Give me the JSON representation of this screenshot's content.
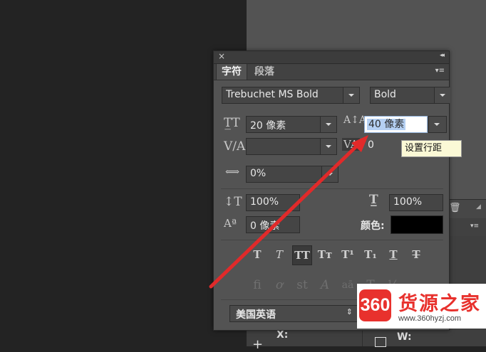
{
  "background": {
    "x_label": "X:",
    "w_label": "W:"
  },
  "panel": {
    "tabs": [
      {
        "label": "字符"
      },
      {
        "label": "段落"
      }
    ],
    "font_family": "Trebuchet MS Bold",
    "font_style": "Bold",
    "font_size": "20 像素",
    "leading": "40 像素",
    "kerning": "",
    "tracking": "0",
    "tsume": "0%",
    "vertical_scale": "100%",
    "horizontal_scale": "100%",
    "baseline_shift": "0 像素",
    "color_label": "颜色:",
    "color_value": "#000000",
    "language": "美国英语",
    "style_buttons": [
      "T",
      "T",
      "TT",
      "Tт",
      "T¹",
      "T₁",
      "T",
      "T"
    ],
    "opentype_buttons": [
      "fi",
      "ơ",
      "st",
      "A",
      "aā",
      "T",
      "½"
    ]
  },
  "tooltip": {
    "text": "设置行距"
  },
  "watermark": {
    "logo_text": "360",
    "brand": "货源之家",
    "url": "www.360hyzj.com"
  },
  "colors": {
    "annotation_arrow": "#e12a2a",
    "panel_bg": "#535353",
    "selection": "#b5d0f3"
  }
}
